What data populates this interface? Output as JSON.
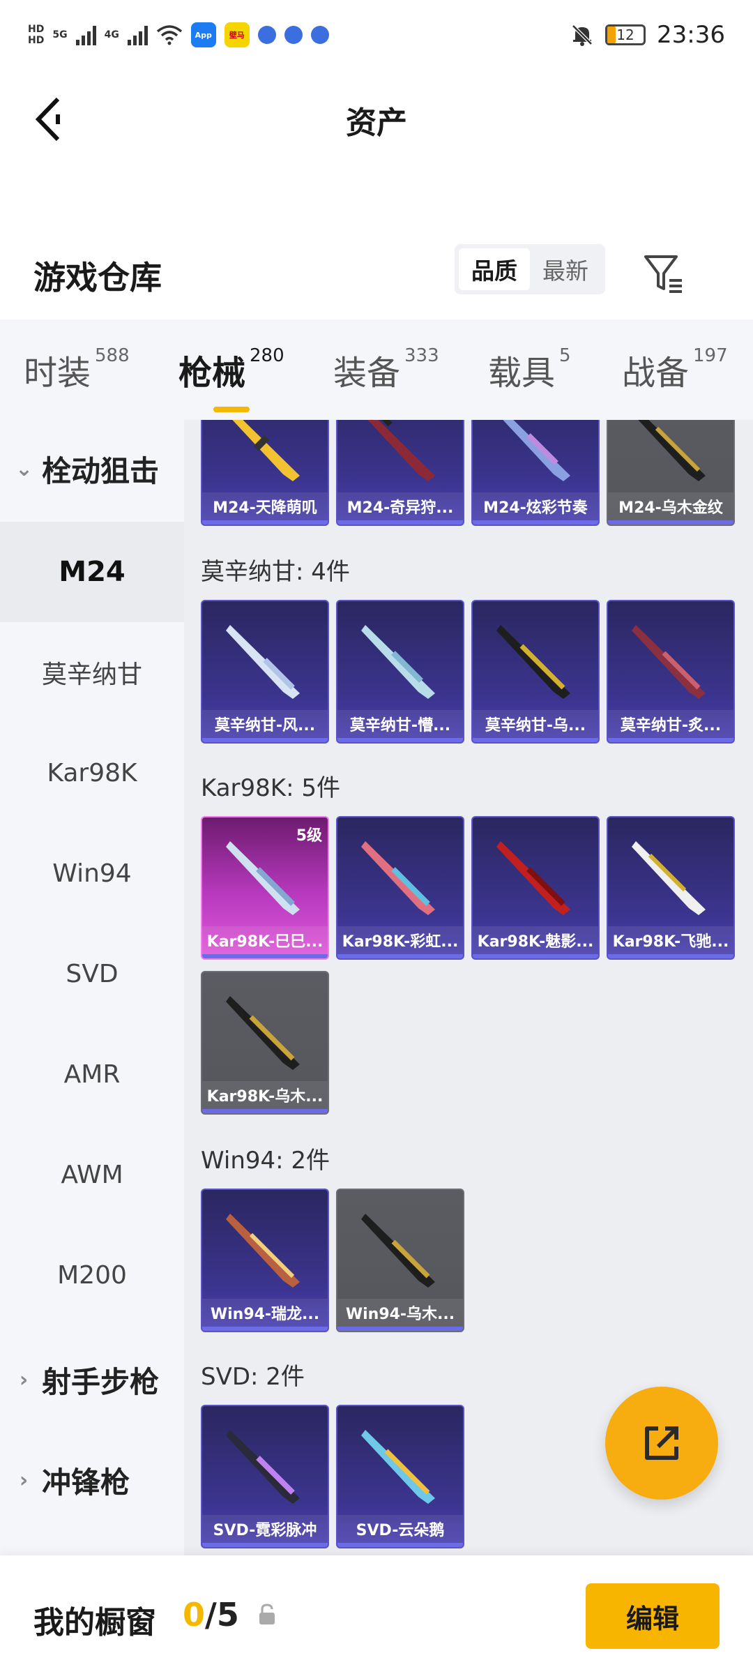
{
  "status_bar": {
    "network_hd1": "HD",
    "network_hd2": "HD",
    "signal1": "5G",
    "signal2": "4G",
    "app_icon_1": "App",
    "app_icon_2": "壁马",
    "battery": "12",
    "time": "23:36"
  },
  "header": {
    "title": "资产"
  },
  "repo": {
    "title": "游戏仓库",
    "sort_options": [
      "品质",
      "最新"
    ],
    "sort_selected": "品质"
  },
  "tabs": [
    {
      "label": "时装",
      "count": "588"
    },
    {
      "label": "枪械",
      "count": "280"
    },
    {
      "label": "装备",
      "count": "333"
    },
    {
      "label": "载具",
      "count": "5"
    },
    {
      "label": "战备",
      "count": "197"
    }
  ],
  "sidebar": {
    "group_bolt": "栓动狙击",
    "items": [
      "M24",
      "莫辛纳甘",
      "Kar98K",
      "Win94",
      "SVD",
      "AMR",
      "AWM",
      "M200"
    ],
    "group_marksman": "射手步枪",
    "group_smg": "冲锋枪"
  },
  "content": {
    "m24_cards": [
      "M24-天降萌叽",
      "M24-奇异狩...",
      "M24-炫彩节奏",
      "M24-乌木金纹"
    ],
    "mosin_title": "莫辛纳甘: 4件",
    "mosin_cards": [
      "莫辛纳甘-风...",
      "莫辛纳甘-懵...",
      "莫辛纳甘-乌...",
      "莫辛纳甘-炙..."
    ],
    "kar_title": "Kar98K: 5件",
    "kar_cards": [
      "Kar98K-巳巳...",
      "Kar98K-彩虹...",
      "Kar98K-魅影...",
      "Kar98K-飞驰...",
      "Kar98K-乌木..."
    ],
    "kar_level": "5级",
    "win_title": "Win94: 2件",
    "win_cards": [
      "Win94-瑞龙...",
      "Win94-乌木..."
    ],
    "svd_title": "SVD: 2件",
    "svd_cards": [
      "SVD-霓彩脉冲",
      "SVD-云朵鹅"
    ]
  },
  "bottom": {
    "showcase_label": "我的橱窗",
    "showcase_current": "0",
    "showcase_sep": "/5",
    "edit_label": "编辑"
  },
  "colors": {
    "accent": "#f7b500",
    "card_purple": "#3c3590",
    "card_gray": "#5a5c62",
    "card_pink": "#b83abf"
  }
}
